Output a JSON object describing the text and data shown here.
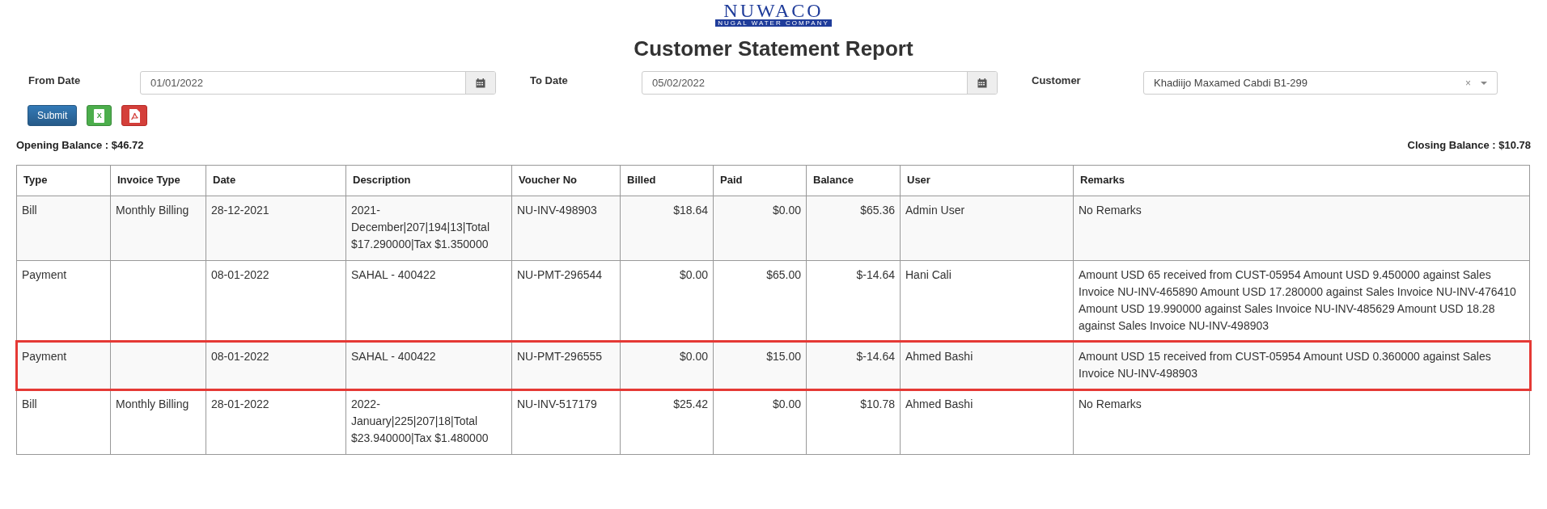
{
  "logo": {
    "name": "NUWACO",
    "tagline": "NUGAL WATER COMPANY"
  },
  "title": "Customer Statement Report",
  "filters": [
    {
      "label": "From Date",
      "kind": "date",
      "value": "01/01/2022"
    },
    {
      "label": "To Date",
      "kind": "date",
      "value": "05/02/2022"
    },
    {
      "label": "Customer",
      "kind": "select",
      "value": "Khadiijo Maxamed Cabdi B1-299",
      "clear": "×"
    }
  ],
  "buttons": [
    {
      "kind": "submit",
      "label": "Submit"
    },
    {
      "kind": "excel",
      "label": "X"
    },
    {
      "kind": "pdf"
    }
  ],
  "opening_balance": "Opening Balance : $46.72",
  "closing_balance": "Closing Balance : $10.78",
  "table": {
    "columns": [
      {
        "label": "Type",
        "numeric": false
      },
      {
        "label": "Invoice Type",
        "numeric": false
      },
      {
        "label": "Date",
        "numeric": false
      },
      {
        "label": "Description",
        "numeric": false
      },
      {
        "label": "Voucher No",
        "numeric": false
      },
      {
        "label": "Billed",
        "numeric": true
      },
      {
        "label": "Paid",
        "numeric": true
      },
      {
        "label": "Balance",
        "numeric": true
      },
      {
        "label": "User",
        "numeric": false
      },
      {
        "label": "Remarks",
        "numeric": false
      }
    ],
    "rows": [
      {
        "highlighted": false,
        "cells": [
          "Bill",
          "Monthly Billing",
          "28-12-2021",
          "2021-December|207|194|13|Total $17.290000|Tax $1.350000",
          "NU-INV-498903",
          "$18.64",
          "$0.00",
          "$65.36",
          "Admin User",
          "No Remarks"
        ]
      },
      {
        "highlighted": false,
        "cells": [
          "Payment",
          "",
          "08-01-2022",
          "SAHAL - 400422",
          "NU-PMT-296544",
          "$0.00",
          "$65.00",
          "$-14.64",
          "Hani Cali",
          "Amount USD 65 received from CUST-05954 Amount USD 9.450000 against Sales Invoice NU-INV-465890 Amount USD 17.280000 against Sales Invoice NU-INV-476410 Amount USD 19.990000 against Sales Invoice NU-INV-485629 Amount USD 18.28 against Sales Invoice NU-INV-498903"
        ]
      },
      {
        "highlighted": true,
        "cells": [
          "Payment",
          "",
          "08-01-2022",
          "SAHAL - 400422",
          "NU-PMT-296555",
          "$0.00",
          "$15.00",
          "$-14.64",
          "Ahmed Bashi",
          "Amount USD 15 received from CUST-05954 Amount USD 0.360000 against Sales Invoice NU-INV-498903"
        ]
      },
      {
        "highlighted": false,
        "cells": [
          "Bill",
          "Monthly Billing",
          "28-01-2022",
          "2022-January|225|207|18|Total $23.940000|Tax $1.480000",
          "NU-INV-517179",
          "$25.42",
          "$0.00",
          "$10.78",
          "Ahmed Bashi",
          "No Remarks"
        ]
      }
    ]
  }
}
